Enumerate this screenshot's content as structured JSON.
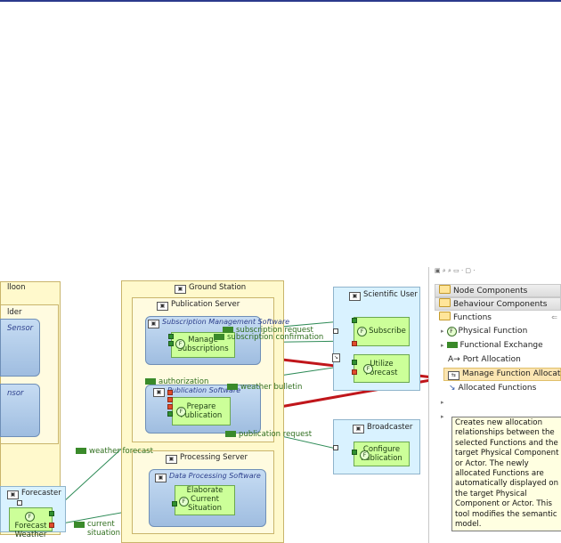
{
  "left_partial": {
    "balloon_label": "lloon",
    "holder_label": "lder",
    "sensor_label_1": "Sensor",
    "sensor_label_2": "nsor",
    "forecaster_label": "Forecaster",
    "forecast_weather": "Forecast\nWeather"
  },
  "ground_station": {
    "title": "Ground Station",
    "publication_server": {
      "title": "Publication Server",
      "subscription_sw": "Subscription Management Software",
      "manage_subscriptions": "Manage\nSubscriptions",
      "publication_sw": "Publication Software",
      "prepare_publication": "Prepare\nPublication"
    },
    "processing_server": {
      "title": "Processing Server",
      "data_processing_sw": "Data Processing Software",
      "elaborate": "Elaborate\nCurrent\nSituation"
    }
  },
  "scientific_user": {
    "title": "Scientific User",
    "subscribe": "Subscribe",
    "utilize_forecast": "Utilize\nForecast"
  },
  "broadcaster": {
    "title": "Broadcaster",
    "configure_publication": "Configure\nPublication"
  },
  "exchanges": {
    "subscription_request": "subscription request",
    "subscription_confirmation": "subscription confirmation",
    "authorization": "authorization",
    "weather_bulletin": "weather bulletin",
    "publication_request": "publication request",
    "weather_forecast": "weather forecast",
    "current_situation": "current\nsituation"
  },
  "palette": {
    "groups": [
      "Node Components",
      "Behaviour Components",
      "Functions"
    ],
    "items": [
      "Physical Function",
      "Functional Exchange",
      "Port Allocation",
      "Manage Function Allocation",
      "Allocated Functions"
    ],
    "tooltip": "Creates new allocation relationships between the selected Functions and the target Physical Component or Actor. The newly allocated Functions are automatically displayed on the target Physical Component or Actor. This tool modifies the semantic model."
  },
  "colors": {
    "allocation_arrow": "#c0161b",
    "exchange_line": "#2e8b57",
    "function_fill": "#ccff99"
  }
}
